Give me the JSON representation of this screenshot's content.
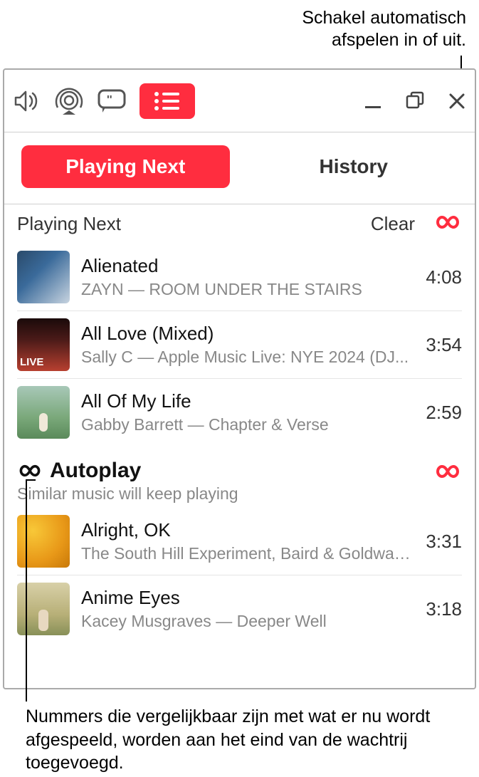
{
  "callouts": {
    "top": "Schakel automatisch\nafspelen in of uit.",
    "bottom": "Nummers die vergelijkbaar zijn met wat er nu wordt afgespeeld, worden aan het eind van de wachtrij toegevoegd."
  },
  "tabs": {
    "playing_next": "Playing Next",
    "history": "History"
  },
  "section": {
    "title": "Playing Next",
    "clear": "Clear"
  },
  "autoplay": {
    "title": "Autoplay",
    "subtitle": "Similar music will keep playing"
  },
  "queue": [
    {
      "title": "Alienated",
      "subtitle": "ZAYN — ROOM UNDER THE STAIRS",
      "duration": "4:08",
      "art": "art1"
    },
    {
      "title": "All Love (Mixed)",
      "subtitle": "Sally C — Apple Music Live: NYE 2024 (DJ...",
      "duration": "3:54",
      "art": "art2"
    },
    {
      "title": "All Of My Life",
      "subtitle": "Gabby Barrett — Chapter & Verse",
      "duration": "2:59",
      "art": "art3"
    }
  ],
  "autoplay_queue": [
    {
      "title": "Alright, OK",
      "subtitle": "The South Hill Experiment, Baird & Goldwas...",
      "duration": "3:31",
      "art": "art4"
    },
    {
      "title": "Anime Eyes",
      "subtitle": "Kacey Musgraves — Deeper Well",
      "duration": "3:18",
      "art": "art5"
    }
  ]
}
